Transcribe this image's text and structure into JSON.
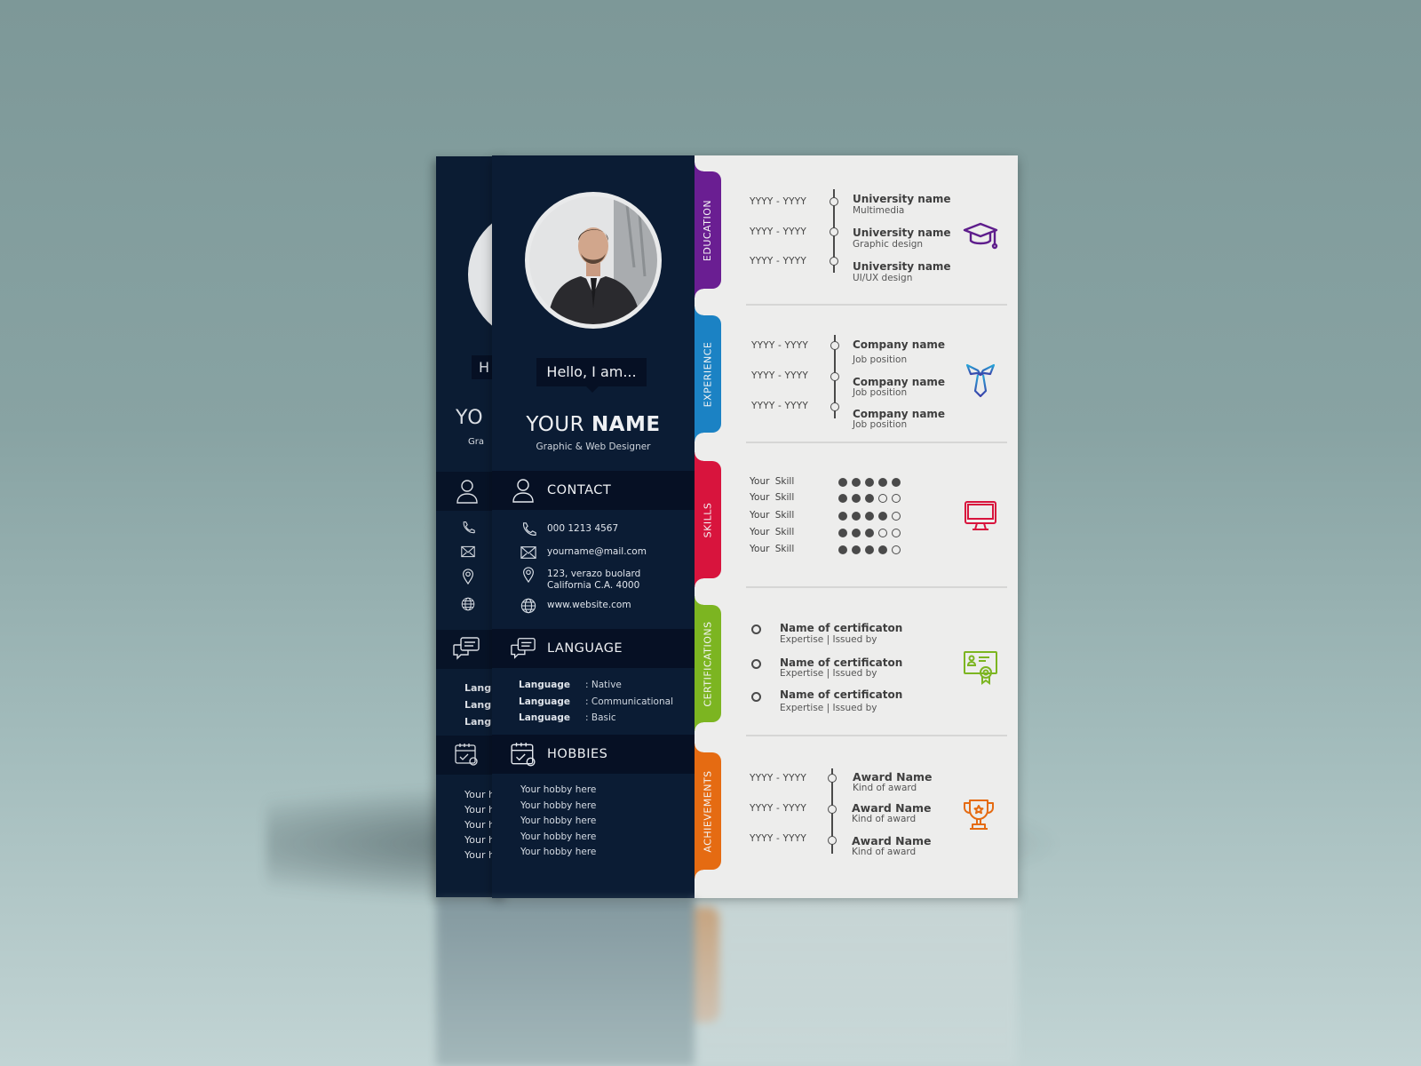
{
  "resume": {
    "greeting": "Hello, I am...",
    "name_first": "YOUR",
    "name_last": "NAME",
    "role": "Graphic & Web Designer",
    "contact": {
      "title": "CONTACT",
      "phone": "000 1213 4567",
      "email": "yourname@mail.com",
      "address_line1": "123, verazo buolard",
      "address_line2": "California C.A. 4000",
      "website": "www.website.com"
    },
    "language": {
      "title": "LANGUAGE",
      "items": [
        {
          "label": "Language",
          "level": ": Native"
        },
        {
          "label": "Language",
          "level": ": Communicational"
        },
        {
          "label": "Language",
          "level": ": Basic"
        }
      ]
    },
    "hobbies": {
      "title": "HOBBIES",
      "items": [
        "Your hobby here",
        "Your hobby here",
        "Your hobby here",
        "Your hobby here",
        "Your hobby here"
      ]
    },
    "back_sheet": {
      "lang_fragment": "Langu",
      "hobby_fragment": "Your h",
      "hello_fragment": "H",
      "name_fragment": "YO",
      "role_fragment": "Gra"
    },
    "sections": {
      "education": {
        "tab": "EDUCATION",
        "color": "#6a1e92",
        "icon": "graduation-cap-icon",
        "items": [
          {
            "date": "YYYY - YYYY",
            "title": "University name",
            "sub": "Multimedia"
          },
          {
            "date": "YYYY - YYYY",
            "title": "University name",
            "sub": "Graphic design"
          },
          {
            "date": "YYYY - YYYY",
            "title": "University name",
            "sub": "UI/UX design"
          }
        ]
      },
      "experience": {
        "tab": "EXPERIENCE",
        "color": "#1b82c4",
        "icon": "necktie-icon",
        "items": [
          {
            "date": "YYYY - YYYY",
            "title": "Company name",
            "sub": "Job position"
          },
          {
            "date": "YYYY - YYYY",
            "title": "Company name",
            "sub": "Job position"
          },
          {
            "date": "YYYY - YYYY",
            "title": "Company name",
            "sub": "Job position"
          }
        ]
      },
      "skills": {
        "tab": "SKILLS",
        "color": "#d8143d",
        "icon": "monitor-icon",
        "max": 5,
        "items": [
          {
            "label": "Your Skill",
            "level": 5
          },
          {
            "label": "Your Skill",
            "level": 3
          },
          {
            "label": "Your Skill",
            "level": 4
          },
          {
            "label": "Your Skill",
            "level": 3
          },
          {
            "label": "Your Skill",
            "level": 4
          }
        ]
      },
      "certifications": {
        "tab": "CERTIFICATIONS",
        "color": "#7cb521",
        "icon": "certificate-icon",
        "items": [
          {
            "title": "Name of certificaton",
            "sub": "Expertise | Issued by"
          },
          {
            "title": "Name of certificaton",
            "sub": "Expertise | Issued by"
          },
          {
            "title": "Name of certificaton",
            "sub": "Expertise | Issued by"
          }
        ]
      },
      "achievements": {
        "tab": "ACHIEVEMENTS",
        "color": "#e56b12",
        "icon": "trophy-icon",
        "items": [
          {
            "date": "YYYY - YYYY",
            "title": "Award Name",
            "sub": "Kind of award"
          },
          {
            "date": "YYYY - YYYY",
            "title": "Award Name",
            "sub": "Kind of award"
          },
          {
            "date": "YYYY - YYYY",
            "title": "Award Name",
            "sub": "Kind of award"
          }
        ]
      }
    }
  }
}
